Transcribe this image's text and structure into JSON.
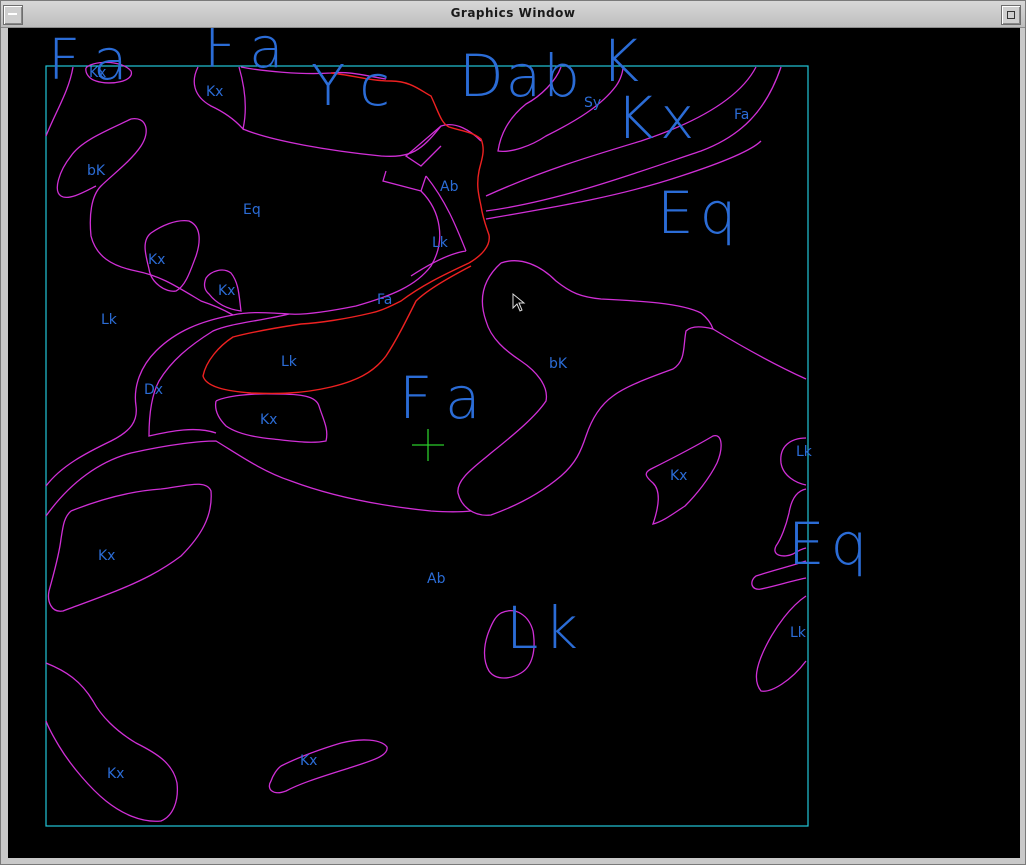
{
  "window": {
    "title": "Graphics Window"
  },
  "colors": {
    "frame": "#22c6d8",
    "boundary": "#d02fd6",
    "highlight": "#ee2121",
    "label": "#2b6cd6",
    "crosshair": "#2bcc2b"
  },
  "labels": {
    "big_fa_top_left": "Fa",
    "kx_top_left": "Kx",
    "big_fa_top": "Fa",
    "kx_top": "Kx",
    "big_yc": "Yc",
    "big_dab": "Dab",
    "big_k": "K",
    "sy": "Sy",
    "big_kx_right": "Kx",
    "fa_top_right": "Fa",
    "bk_left": "bK",
    "eq_center": "Eq",
    "ab_top": "Ab",
    "big_eq_right": "Eq",
    "lk_mid": "Lk",
    "kx_left": "Kx",
    "kx_left2": "Kx",
    "fa_mid": "Fa",
    "lk_left": "Lk",
    "lk_red": "Lk",
    "bk_right": "bK",
    "dx": "Dx",
    "big_fa_center": "Fa",
    "kx_center": "Kx",
    "lk_edge": "Lk",
    "kx_right": "Kx",
    "big_eq_edge": "Eq",
    "kx_lower_left": "Kx",
    "ab_center": "Ab",
    "big_lk": "Lk",
    "lk_lower_edge": "Lk",
    "kx_bottom_left": "Kx",
    "kx_bottom": "Kx"
  }
}
